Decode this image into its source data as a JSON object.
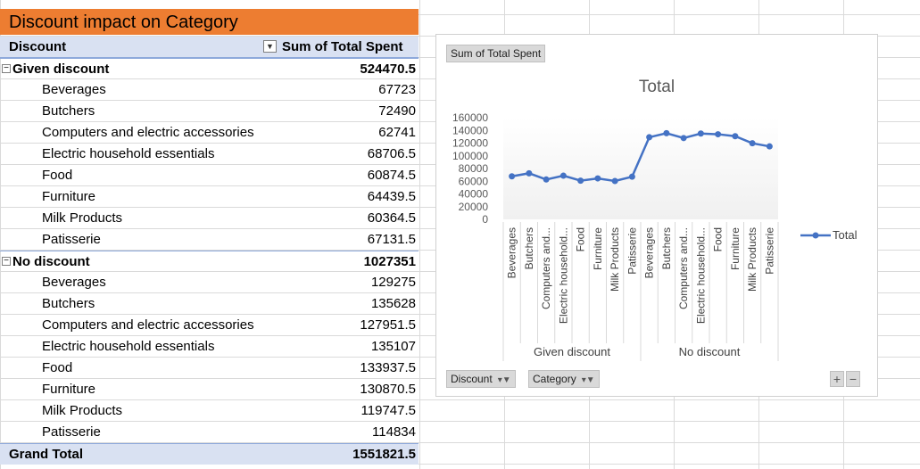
{
  "title": "Discount impact on Category",
  "pivot": {
    "header_left": "Discount",
    "header_right": "Sum of Total Spent",
    "groups": [
      {
        "label": "Given discount",
        "total": "524470.5",
        "items": [
          {
            "label": "Beverages",
            "value": "67723"
          },
          {
            "label": "Butchers",
            "value": "72490"
          },
          {
            "label": "Computers and electric accessories",
            "value": "62741"
          },
          {
            "label": "Electric household essentials",
            "value": "68706.5"
          },
          {
            "label": "Food",
            "value": "60874.5"
          },
          {
            "label": "Furniture",
            "value": "64439.5"
          },
          {
            "label": "Milk Products",
            "value": "60364.5"
          },
          {
            "label": "Patisserie",
            "value": "67131.5"
          }
        ]
      },
      {
        "label": "No discount",
        "total": "1027351",
        "items": [
          {
            "label": "Beverages",
            "value": "129275"
          },
          {
            "label": "Butchers",
            "value": "135628"
          },
          {
            "label": "Computers and electric accessories",
            "value": "127951.5"
          },
          {
            "label": "Electric household essentials",
            "value": "135107"
          },
          {
            "label": "Food",
            "value": "133937.5"
          },
          {
            "label": "Furniture",
            "value": "130870.5"
          },
          {
            "label": "Milk Products",
            "value": "119747.5"
          },
          {
            "label": "Patisserie",
            "value": "114834"
          }
        ]
      }
    ],
    "grand_label": "Grand Total",
    "grand_total": "1551821.5"
  },
  "chart_ui": {
    "value_button": "Sum of Total Spent",
    "axis_button_1": "Discount",
    "axis_button_2": "Category",
    "plus": "+",
    "minus": "−"
  },
  "chart_data": {
    "type": "line",
    "title": "Total",
    "legend": "Total",
    "legend_position": "right",
    "ylim": [
      0,
      160000
    ],
    "yticks": [
      "160000",
      "140000",
      "120000",
      "100000",
      "80000",
      "60000",
      "40000",
      "20000",
      "0"
    ],
    "groups": [
      "Given discount",
      "No discount"
    ],
    "categories": [
      "Beverages",
      "Butchers",
      "Computers and...",
      "Electric household...",
      "Food",
      "Furniture",
      "Milk Products",
      "Patisserie",
      "Beverages",
      "Butchers",
      "Computers and...",
      "Electric household...",
      "Food",
      "Furniture",
      "Milk Products",
      "Patisserie"
    ],
    "series": [
      {
        "name": "Total",
        "color": "#4472c4",
        "values": [
          67723,
          72490,
          62741,
          68706.5,
          60874.5,
          64439.5,
          60364.5,
          67131.5,
          129275,
          135628,
          127951.5,
          135107,
          133937.5,
          130870.5,
          119747.5,
          114834
        ]
      }
    ]
  }
}
